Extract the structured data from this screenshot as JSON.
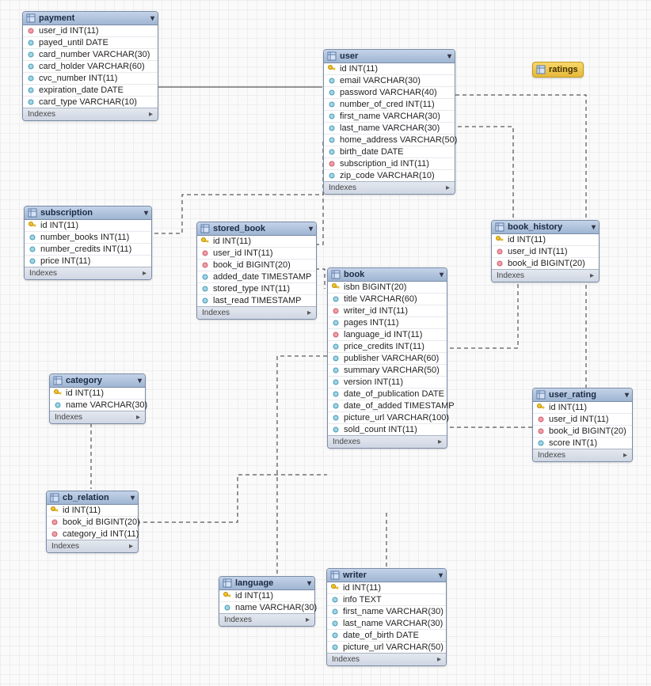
{
  "indexes_label": "Indexes",
  "tables": {
    "payment": {
      "name": "payment",
      "rows": [
        {
          "icon": "fk",
          "label": "user_id INT(11)"
        },
        {
          "icon": "col",
          "label": "payed_until DATE"
        },
        {
          "icon": "col",
          "label": "card_number VARCHAR(30)"
        },
        {
          "icon": "col",
          "label": "card_holder VARCHAR(60)"
        },
        {
          "icon": "col",
          "label": "cvc_number INT(11)"
        },
        {
          "icon": "col",
          "label": "expiration_date DATE"
        },
        {
          "icon": "col",
          "label": "card_type VARCHAR(10)"
        }
      ]
    },
    "user": {
      "name": "user",
      "rows": [
        {
          "icon": "pk",
          "label": "id INT(11)"
        },
        {
          "icon": "col",
          "label": "email VARCHAR(30)"
        },
        {
          "icon": "col",
          "label": "password VARCHAR(40)"
        },
        {
          "icon": "col",
          "label": "number_of_cred INT(11)"
        },
        {
          "icon": "col",
          "label": "first_name VARCHAR(30)"
        },
        {
          "icon": "col",
          "label": "last_name VARCHAR(30)"
        },
        {
          "icon": "col",
          "label": "home_address VARCHAR(50)"
        },
        {
          "icon": "col",
          "label": "birth_date DATE"
        },
        {
          "icon": "fk",
          "label": "subscription_id INT(11)"
        },
        {
          "icon": "col",
          "label": "zip_code VARCHAR(10)"
        }
      ]
    },
    "subscription": {
      "name": "subscription",
      "rows": [
        {
          "icon": "pk",
          "label": "id INT(11)"
        },
        {
          "icon": "col",
          "label": "number_books INT(11)"
        },
        {
          "icon": "col",
          "label": "number_credits INT(11)"
        },
        {
          "icon": "col",
          "label": "price INT(11)"
        }
      ]
    },
    "stored_book": {
      "name": "stored_book",
      "rows": [
        {
          "icon": "pk",
          "label": "id INT(11)"
        },
        {
          "icon": "fk",
          "label": "user_id INT(11)"
        },
        {
          "icon": "fk",
          "label": "book_id BIGINT(20)"
        },
        {
          "icon": "col",
          "label": "added_date TIMESTAMP"
        },
        {
          "icon": "col",
          "label": "stored_type INT(11)"
        },
        {
          "icon": "col",
          "label": "last_read TIMESTAMP"
        }
      ]
    },
    "book": {
      "name": "book",
      "rows": [
        {
          "icon": "pk",
          "label": "isbn BIGINT(20)"
        },
        {
          "icon": "col",
          "label": "title VARCHAR(60)"
        },
        {
          "icon": "fk",
          "label": "writer_id INT(11)"
        },
        {
          "icon": "col",
          "label": "pages INT(11)"
        },
        {
          "icon": "fk",
          "label": "language_id INT(11)"
        },
        {
          "icon": "col",
          "label": "price_credits INT(11)"
        },
        {
          "icon": "col",
          "label": "publisher VARCHAR(60)"
        },
        {
          "icon": "col",
          "label": "summary VARCHAR(50)"
        },
        {
          "icon": "col",
          "label": "version INT(11)"
        },
        {
          "icon": "col",
          "label": "date_of_publication DATE"
        },
        {
          "icon": "col",
          "label": "date_of_added TIMESTAMP"
        },
        {
          "icon": "col",
          "label": "picture_url VARCHAR(100)"
        },
        {
          "icon": "col",
          "label": "sold_count INT(11)"
        }
      ]
    },
    "book_history": {
      "name": "book_history",
      "rows": [
        {
          "icon": "pk",
          "label": "id INT(11)"
        },
        {
          "icon": "fk",
          "label": "user_id INT(11)"
        },
        {
          "icon": "fk",
          "label": "book_id BIGINT(20)"
        }
      ]
    },
    "category": {
      "name": "category",
      "rows": [
        {
          "icon": "pk",
          "label": "id INT(11)"
        },
        {
          "icon": "col",
          "label": "name VARCHAR(30)"
        }
      ]
    },
    "cb_relation": {
      "name": "cb_relation",
      "rows": [
        {
          "icon": "pk",
          "label": "id INT(11)"
        },
        {
          "icon": "fk",
          "label": "book_id BIGINT(20)"
        },
        {
          "icon": "fk",
          "label": "category_id INT(11)"
        }
      ]
    },
    "user_rating": {
      "name": "user_rating",
      "rows": [
        {
          "icon": "pk",
          "label": "id INT(11)"
        },
        {
          "icon": "fk",
          "label": "user_id INT(11)"
        },
        {
          "icon": "fk",
          "label": "book_id BIGINT(20)"
        },
        {
          "icon": "col",
          "label": "score INT(1)"
        }
      ]
    },
    "language": {
      "name": "language",
      "rows": [
        {
          "icon": "pk",
          "label": "id INT(11)"
        },
        {
          "icon": "col",
          "label": "name VARCHAR(30)"
        }
      ]
    },
    "writer": {
      "name": "writer",
      "rows": [
        {
          "icon": "pk",
          "label": "id INT(11)"
        },
        {
          "icon": "col",
          "label": "info TEXT"
        },
        {
          "icon": "col",
          "label": "first_name VARCHAR(30)"
        },
        {
          "icon": "col",
          "label": "last_name VARCHAR(30)"
        },
        {
          "icon": "col",
          "label": "date_of_birth DATE"
        },
        {
          "icon": "col",
          "label": "picture_url VARCHAR(50)"
        }
      ]
    }
  },
  "ratings_name": "ratings"
}
